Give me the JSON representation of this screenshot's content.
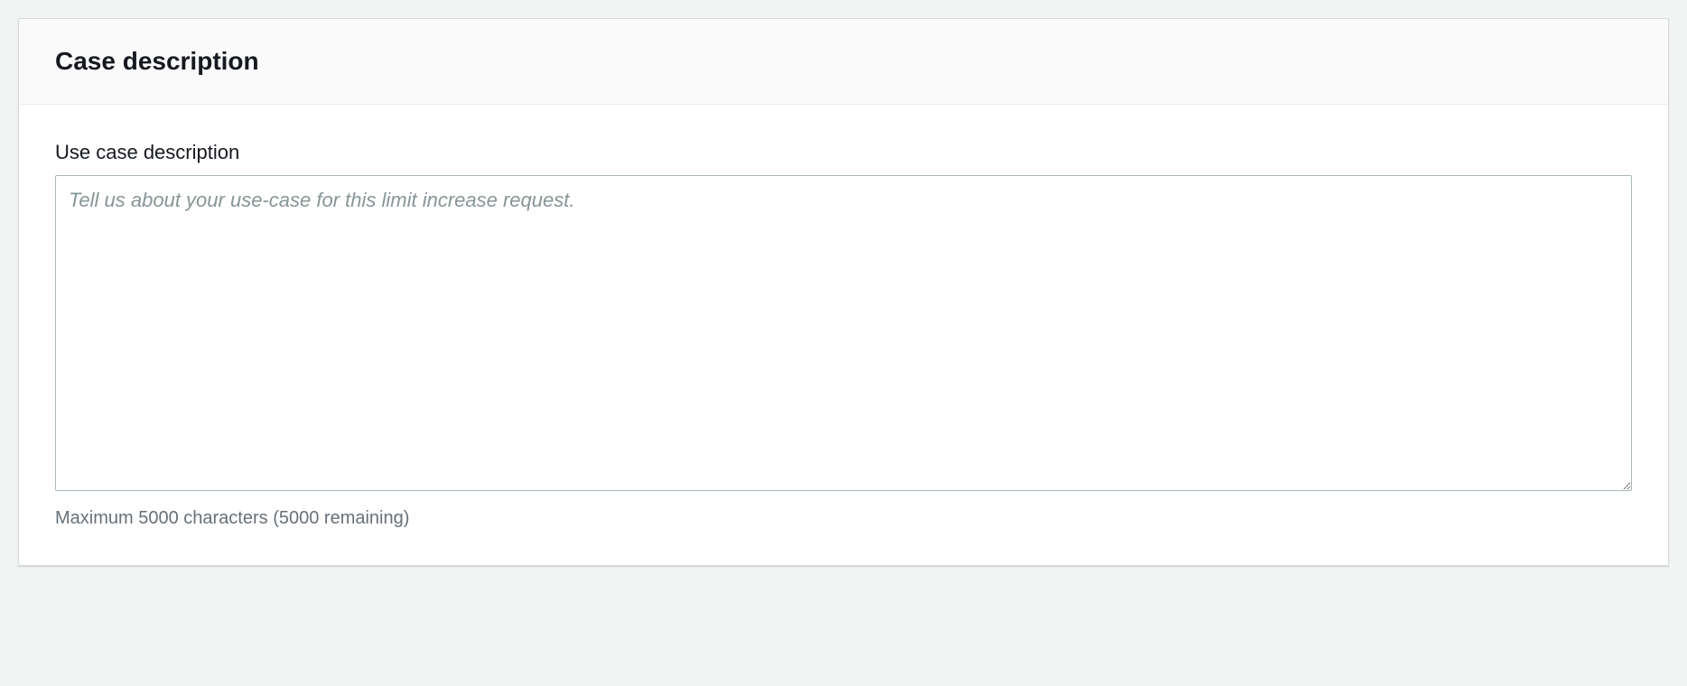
{
  "panel": {
    "title": "Case description"
  },
  "form": {
    "label": "Use case description",
    "placeholder": "Tell us about your use-case for this limit increase request.",
    "value": "",
    "helpText": "Maximum 5000 characters (5000 remaining)"
  }
}
